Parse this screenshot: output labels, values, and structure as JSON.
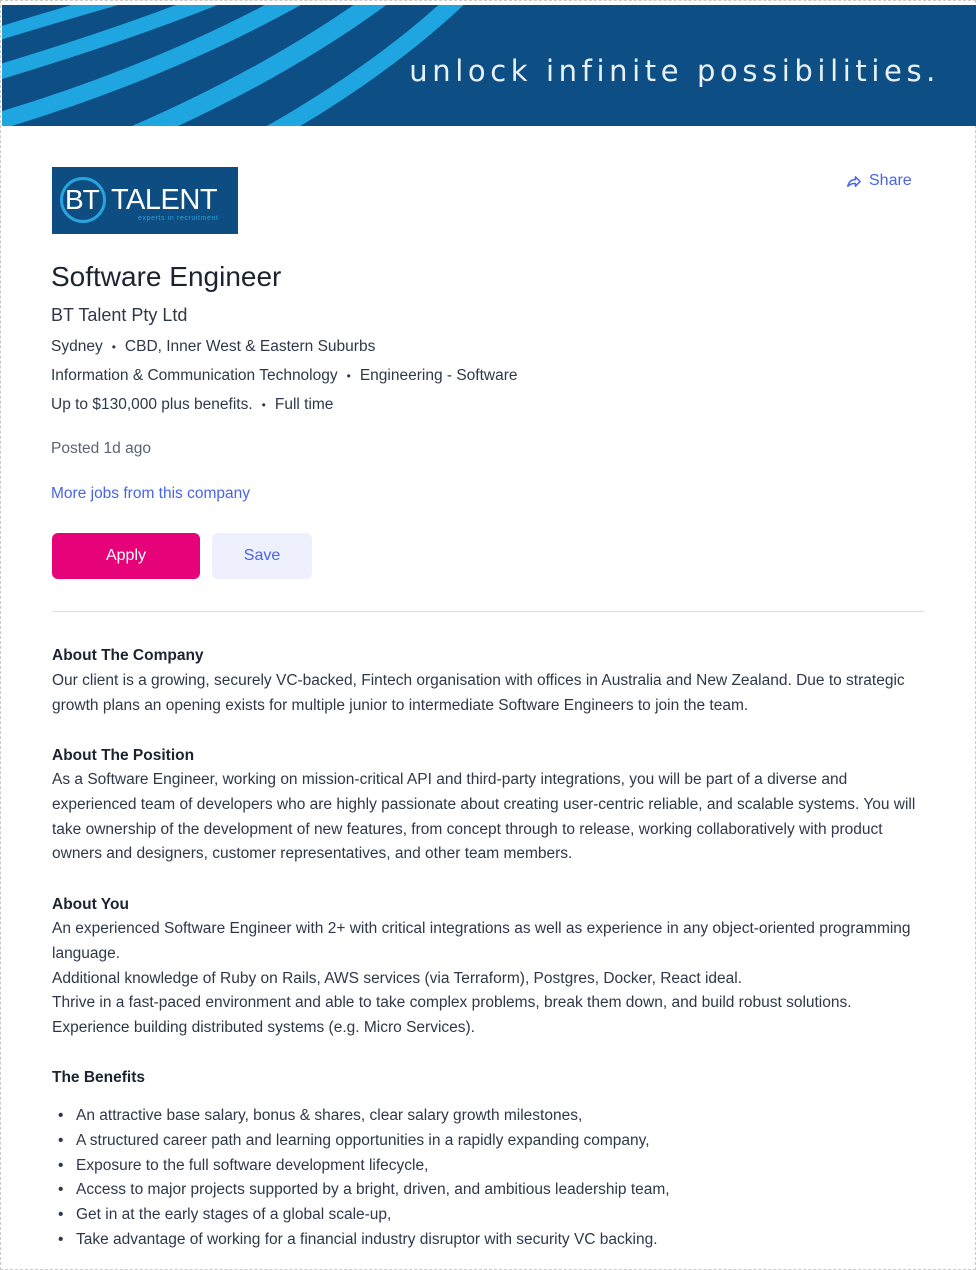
{
  "banner": {
    "tagline": "unlock infinite possibilities.",
    "background_color": "#0d4f85",
    "accent_color": "#1fa6e0"
  },
  "logo": {
    "mark_text": "BT",
    "word_text": "TALENT",
    "sub_text": "experts in recruitment",
    "icon": "bt-talent-logo"
  },
  "share": {
    "label": "Share",
    "icon": "share-arrow-icon"
  },
  "job": {
    "title": "Software Engineer",
    "company": "BT Talent Pty Ltd",
    "location": "Sydney",
    "area": "CBD, Inner West & Eastern Suburbs",
    "classification": "Information & Communication Technology",
    "subclassification": "Engineering - Software",
    "salary": "Up to $130,000 plus benefits.",
    "work_type": "Full time",
    "posted": "Posted 1d ago",
    "more_jobs_label": "More jobs from this company"
  },
  "actions": {
    "apply_label": "Apply",
    "save_label": "Save",
    "apply_color": "#e60278",
    "link_color": "#4964e9"
  },
  "description": {
    "about_company_heading": "About The Company",
    "about_company_text": "Our client is a growing, securely VC-backed, Fintech organisation with offices in Australia and New Zealand. Due to strategic growth plans an opening exists for multiple junior to intermediate Software Engineers to join the team.",
    "about_position_heading": "About The Position",
    "about_position_text": "As a Software Engineer, working on mission-critical API and third-party integrations, you will be part of a diverse and experienced team of developers who are highly passionate about creating user-centric reliable, and scalable systems. You will take ownership of the development of new features, from concept through to release, working collaboratively with product owners and designers, customer representatives, and other team members.",
    "about_you_heading": "About You",
    "about_you_lines": [
      "An experienced Software Engineer with 2+ with critical integrations as well as experience in any object-oriented programming language.",
      "Additional knowledge of Ruby on Rails, AWS services (via Terraform), Postgres, Docker, React ideal.",
      "Thrive in a fast-paced environment and able to take complex problems, break them down, and build robust solutions.",
      "Experience building distributed systems (e.g. Micro Services)."
    ],
    "benefits_heading": "The Benefits",
    "benefits": [
      "An attractive base salary, bonus & shares, clear salary growth milestones,",
      "A structured career path and learning opportunities in a rapidly expanding company,",
      "Exposure to the full software development lifecycle,",
      "Access to major projects supported by a bright, driven, and ambitious leadership team,",
      "Get in at the early stages of a global scale-up,",
      "Take advantage of working for a financial industry disruptor with security VC backing."
    ]
  }
}
